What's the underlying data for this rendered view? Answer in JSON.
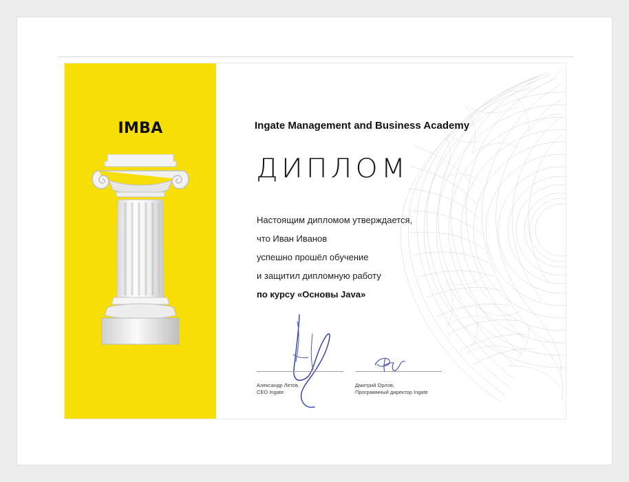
{
  "certificate": {
    "brand": "IMBA",
    "academy": "Ingate Management and Business Academy",
    "title": "ДИПЛОМ",
    "body_lines": [
      "Настоящим дипломом утверждается,",
      "что Иван Иванов",
      "успешно прошёл обучение",
      "и защитил дипломную работу"
    ],
    "course_line": "по курсу «Основы Java»",
    "signatories": [
      {
        "name": "Александр Летов,",
        "role": "CEO Ingate"
      },
      {
        "name": "Дмитрий Орлов,",
        "role": "Программный директор Ingate"
      }
    ]
  },
  "colors": {
    "accent_yellow": "#f7df05",
    "ink_blue": "#3d4aa8",
    "text": "#111111"
  },
  "icons": {
    "column": "ionic-column-icon",
    "signature_left": "signature-icon",
    "signature_right": "signature-icon"
  }
}
